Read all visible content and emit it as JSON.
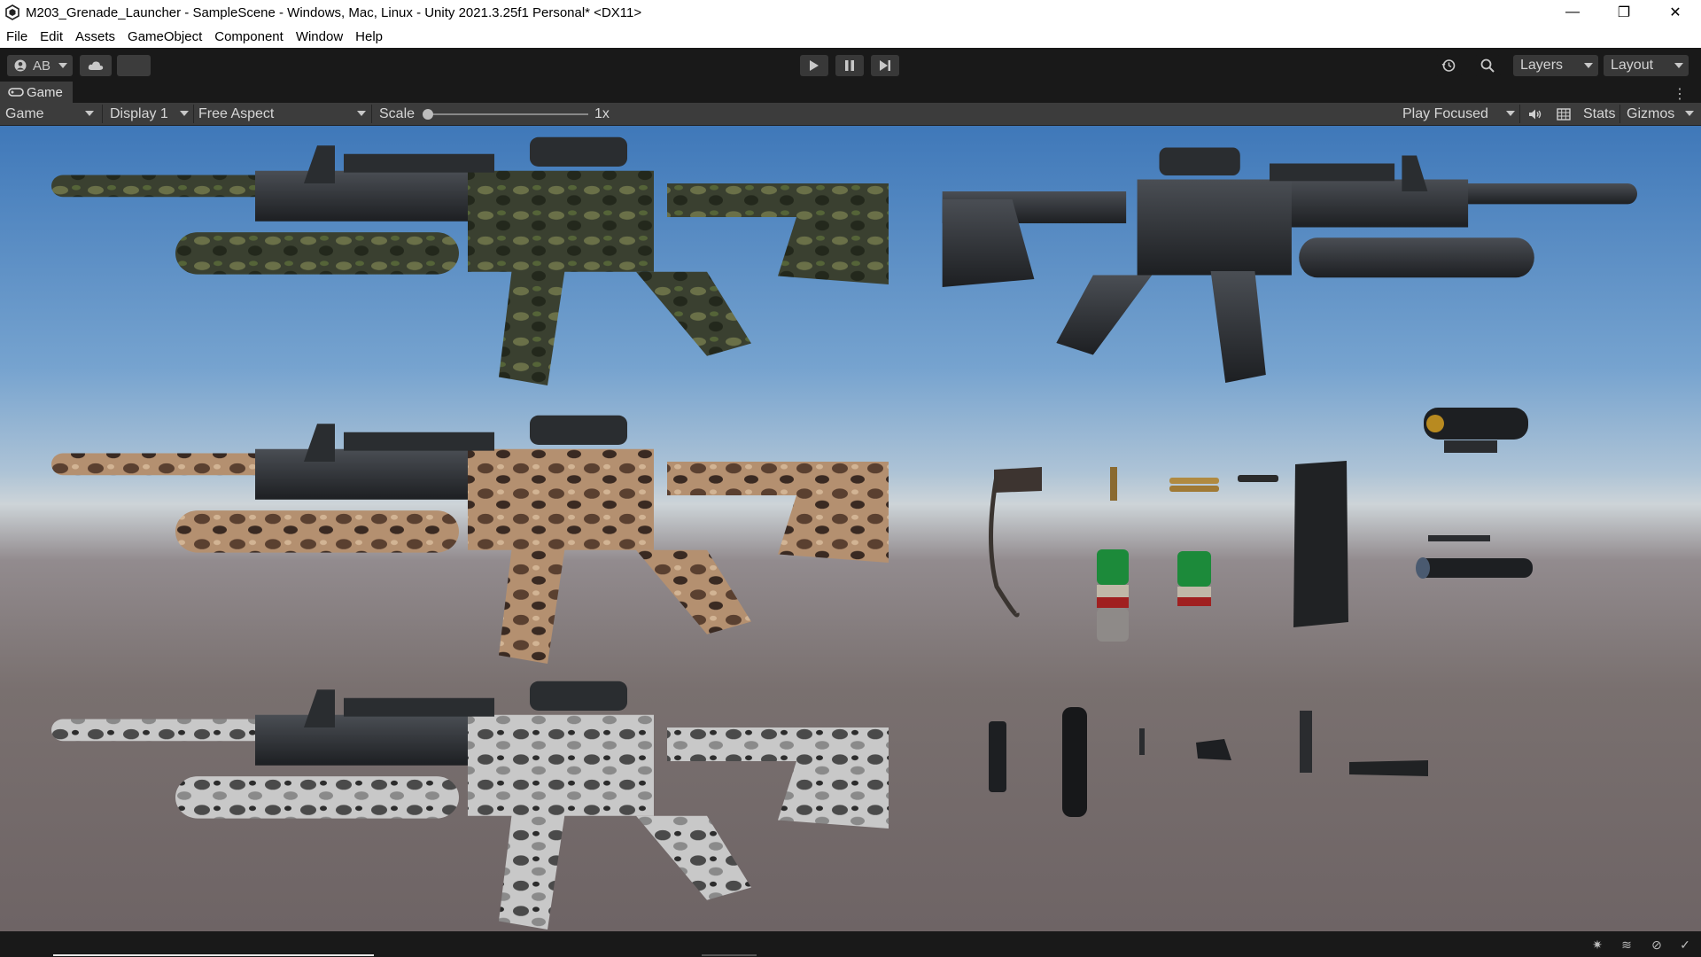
{
  "window": {
    "title": "M203_Grenade_Launcher - SampleScene - Windows, Mac, Linux - Unity 2021.3.25f1 Personal* <DX11>",
    "minimize": "—",
    "maximize": "❐",
    "close": "✕"
  },
  "menu": [
    "File",
    "Edit",
    "Assets",
    "GameObject",
    "Component",
    "Window",
    "Help"
  ],
  "toolbar": {
    "account": "AB",
    "layers": "Layers",
    "layout": "Layout"
  },
  "game_tab": {
    "label": "Game"
  },
  "game_bar": {
    "view_mode": "Game",
    "display": "Display 1",
    "aspect": "Free Aspect",
    "scale_label": "Scale",
    "scale_value": "1x",
    "scale_level": 0.0,
    "play_mode": "Play Focused",
    "stats": "Stats",
    "gizmos": "Gizmos"
  },
  "colors": {
    "sky_top": "#3f78b9",
    "ground": "#6e6465",
    "editor_bg": "#191919",
    "panel": "#3c3c3c"
  }
}
